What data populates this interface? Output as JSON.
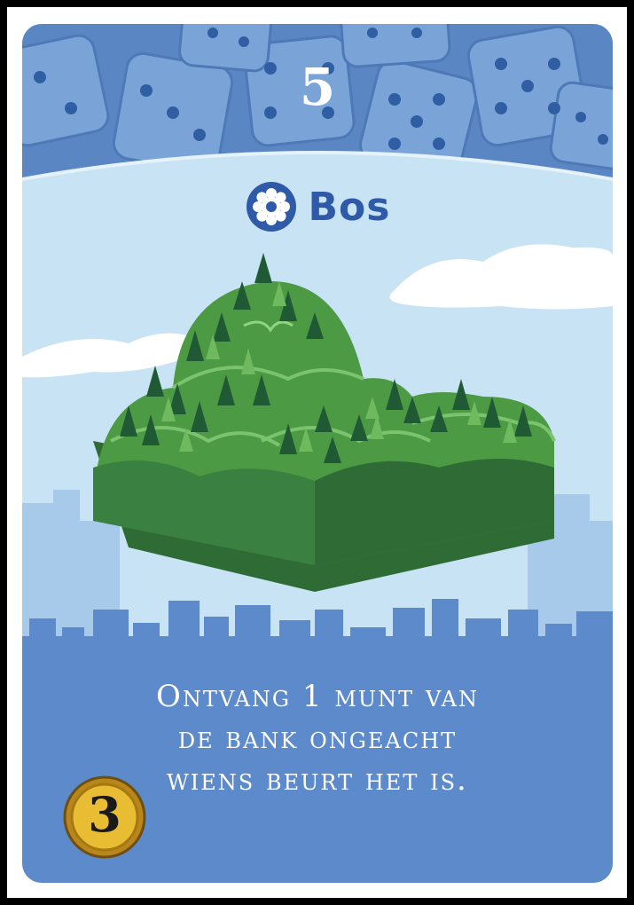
{
  "card": {
    "activation_number": "5",
    "name": "Bos",
    "type_icon": "gear-icon",
    "effect_lines": [
      "Ontvang 1 munt van",
      "de bank ongeacht",
      "wiens beurt het is."
    ],
    "cost": "3",
    "cost_icon": "coin-icon",
    "illustration": "forest-hills-illustration",
    "colors": {
      "header_blue": "#5b86c4",
      "sky": "#c8e3f3",
      "bottom_blue": "#5d8acb",
      "name_blue": "#2f5aa8",
      "forest_green": "#4c9a44",
      "coin_gold": "#d9a922"
    }
  }
}
